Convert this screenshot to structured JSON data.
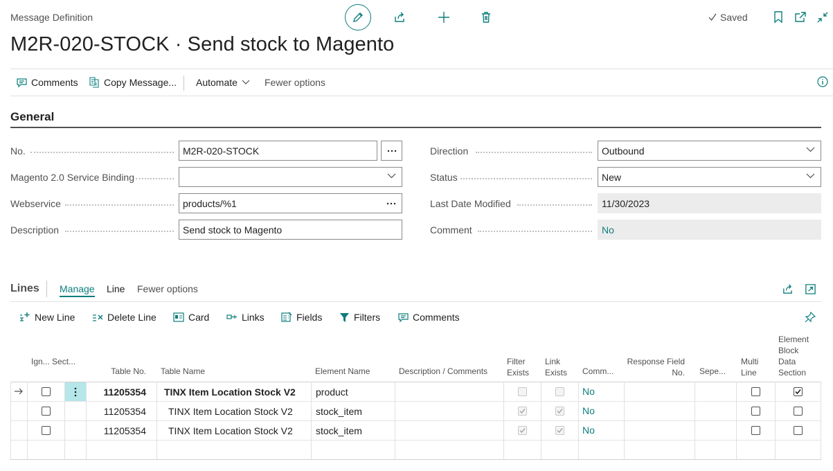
{
  "header": {
    "breadcrumb": "Message Definition",
    "title": "M2R-020-STOCK · Send stock to Magento",
    "saved_label": "Saved"
  },
  "actions": {
    "comments": "Comments",
    "copy_message": "Copy Message...",
    "automate": "Automate",
    "fewer_options": "Fewer options"
  },
  "general": {
    "section_title": "General",
    "fields": {
      "no": {
        "label": "No.",
        "value": "M2R-020-STOCK"
      },
      "service_binding": {
        "label": "Magento 2.0 Service Binding",
        "value": ""
      },
      "webservice": {
        "label": "Webservice",
        "value": "products/%1"
      },
      "description": {
        "label": "Description",
        "value": "Send stock to Magento"
      },
      "direction": {
        "label": "Direction",
        "value": "Outbound"
      },
      "status": {
        "label": "Status",
        "value": "New"
      },
      "last_modified": {
        "label": "Last Date Modified",
        "value": "11/30/2023"
      },
      "comment": {
        "label": "Comment",
        "value": "No"
      }
    }
  },
  "lines": {
    "title": "Lines",
    "tabs": {
      "manage": "Manage",
      "line": "Line",
      "fewer": "Fewer options"
    },
    "toolbar": {
      "new_line": "New Line",
      "delete_line": "Delete Line",
      "card": "Card",
      "links": "Links",
      "fields": "Fields",
      "filters": "Filters",
      "comments": "Comments"
    },
    "columns": {
      "ignore_section": "Ign... Sect...",
      "table_no": "Table No.",
      "table_name": "Table Name",
      "element_name": "Element Name",
      "description": "Description / Comments",
      "filter_exists": "Filter Exists",
      "link_exists": "Link Exists",
      "comment": "Comm...",
      "response_field": "Response Field No.",
      "separator": "Sepe...",
      "multi_line": "Multi Line",
      "element_block": "Element Block Data Section"
    },
    "rows": [
      {
        "table_no": "11205354",
        "table_name": "TINX Item Location Stock V2",
        "element_name": "product",
        "comment": "No",
        "ignore": false,
        "filter_exists": false,
        "link_exists": false,
        "multi_line": false,
        "element_block": true
      },
      {
        "table_no": "11205354",
        "table_name": "TINX Item Location Stock V2",
        "element_name": "stock_item",
        "comment": "No",
        "ignore": false,
        "filter_exists": true,
        "link_exists": true,
        "multi_line": false,
        "element_block": false
      },
      {
        "table_no": "11205354",
        "table_name": "TINX Item Location Stock V2",
        "element_name": "stock_item",
        "comment": "No",
        "ignore": false,
        "filter_exists": true,
        "link_exists": true,
        "multi_line": false,
        "element_block": false
      }
    ]
  },
  "colors": {
    "accent": "#0d7d7d",
    "selected_cell": "#b5e6ea",
    "readonly_bg": "#ececec"
  }
}
